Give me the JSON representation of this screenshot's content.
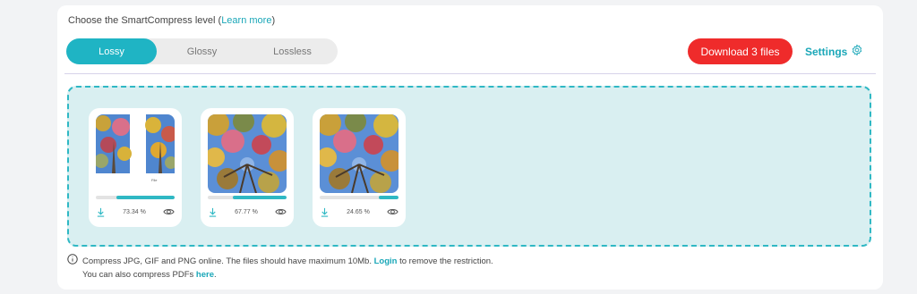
{
  "header": {
    "level_label": "Choose the SmartCompress level (",
    "learn_more": "Learn more",
    "level_label_end": ")"
  },
  "levels": [
    {
      "label": "Lossy",
      "active": true
    },
    {
      "label": "Glossy",
      "active": false
    },
    {
      "label": "Lossless",
      "active": false
    }
  ],
  "download_label": "Download 3 files",
  "settings_label": "Settings",
  "files": [
    {
      "percent": "73.34 %",
      "saved_fraction": 0.7334,
      "thumb_caption": "File",
      "icons": [
        "download-icon",
        "eye-icon"
      ]
    },
    {
      "percent": "67.77 %",
      "saved_fraction": 0.6777,
      "icons": [
        "download-icon",
        "eye-icon"
      ]
    },
    {
      "percent": "24.65 %",
      "saved_fraction": 0.2465,
      "icons": [
        "download-icon",
        "eye-icon"
      ]
    }
  ],
  "footer": {
    "line1_text": "Compress JPG, GIF and PNG online. The files should have maximum 10Mb.",
    "login_label": "Login",
    "line1_end": "to remove the restriction.",
    "line2_text": "You can also compress PDFs",
    "here_label": "here",
    "line2_end": "."
  },
  "colors": {
    "accent": "#1fb4c4",
    "download": "#ef2b2b",
    "dropzone": "#d9eff1"
  }
}
